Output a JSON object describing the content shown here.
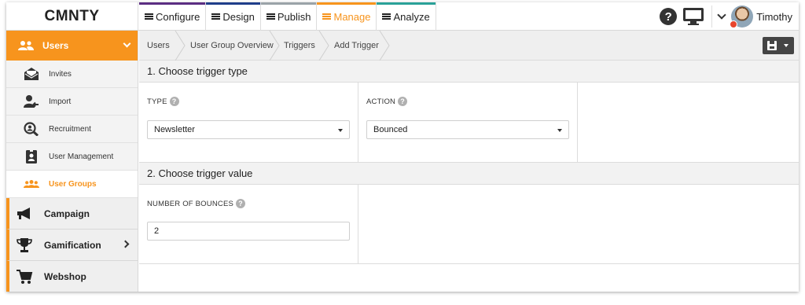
{
  "app": {
    "logo_text": "CMNTY",
    "nav": [
      {
        "label": "Configure"
      },
      {
        "label": "Design"
      },
      {
        "label": "Publish"
      },
      {
        "label": "Manage"
      },
      {
        "label": "Analyze"
      }
    ],
    "accent_color": "#f7941d",
    "help_label": "?",
    "user_name": "Timothy"
  },
  "sidebar": {
    "section": {
      "label": "Users",
      "icon": "users-icon"
    },
    "sub_items": [
      {
        "label": "Invites",
        "icon": "envelope-open-icon"
      },
      {
        "label": "Import",
        "icon": "user-import-icon"
      },
      {
        "label": "Recruitment",
        "icon": "recruitment-search-icon"
      },
      {
        "label": "User Management",
        "icon": "id-badge-icon"
      },
      {
        "label": "User Groups",
        "icon": "user-groups-icon",
        "active": true
      }
    ],
    "main_items": [
      {
        "label": "Campaign",
        "icon": "megaphone-icon"
      },
      {
        "label": "Gamification",
        "icon": "trophy-icon"
      },
      {
        "label": "Webshop",
        "icon": "cart-icon"
      }
    ]
  },
  "breadcrumb": [
    "Users",
    "User Group Overview",
    "Triggers",
    "Add Trigger"
  ],
  "sections": {
    "type": {
      "title": "1. Choose trigger type",
      "type_label": "TYPE",
      "type_value": "Newsletter",
      "action_label": "ACTION",
      "action_value": "Bounced"
    },
    "value": {
      "title": "2. Choose trigger value",
      "bounces_label": "NUMBER OF BOUNCES",
      "bounces_value": "2"
    }
  }
}
